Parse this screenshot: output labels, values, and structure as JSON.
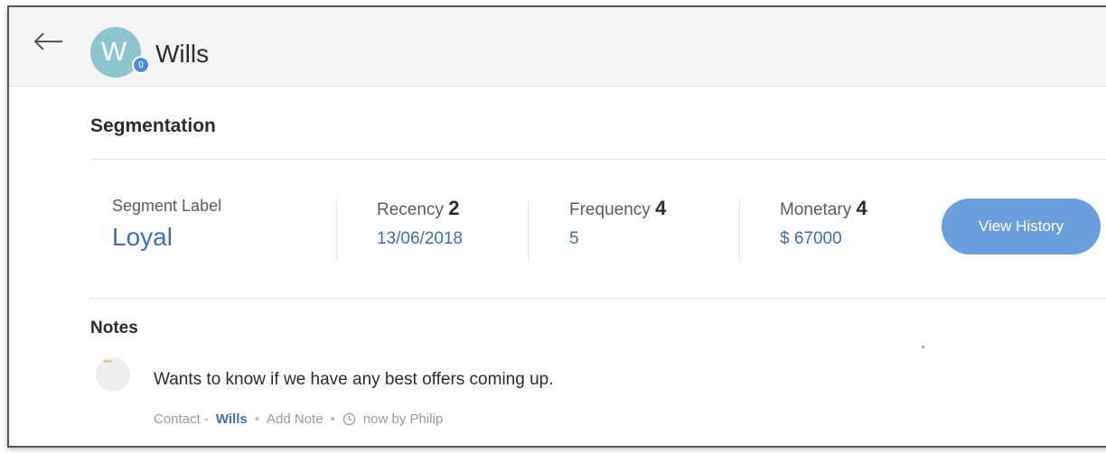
{
  "header": {
    "contact_name": "Wills",
    "avatar_initial": "W",
    "avatar_badge": "0",
    "back_icon": "arrow-left-icon"
  },
  "segmentation": {
    "title": "Segmentation",
    "segment_label": "Segment Label",
    "segment_value": "Loyal",
    "recency_label": "Recency",
    "recency_score": "2",
    "recency_value": "13/06/2018",
    "frequency_label": "Frequency",
    "frequency_score": "4",
    "frequency_value": "5",
    "monetary_label": "Monetary",
    "monetary_score": "4",
    "monetary_value": "$ 67000",
    "view_history_label": "View History"
  },
  "notes": {
    "title": "Notes",
    "items": [
      {
        "text": "Wants to know if we have any best offers coming up.",
        "contact_prefix": "Contact -",
        "contact_link": "Wills",
        "add_note": "Add Note",
        "time_icon": "clock-icon",
        "time_text": "now by  Philip"
      }
    ]
  },
  "colors": {
    "accent": "#3f6fb0",
    "button": "#6a9edc",
    "avatar": "#8cc5ce",
    "header_bg": "#f4f4f5"
  }
}
